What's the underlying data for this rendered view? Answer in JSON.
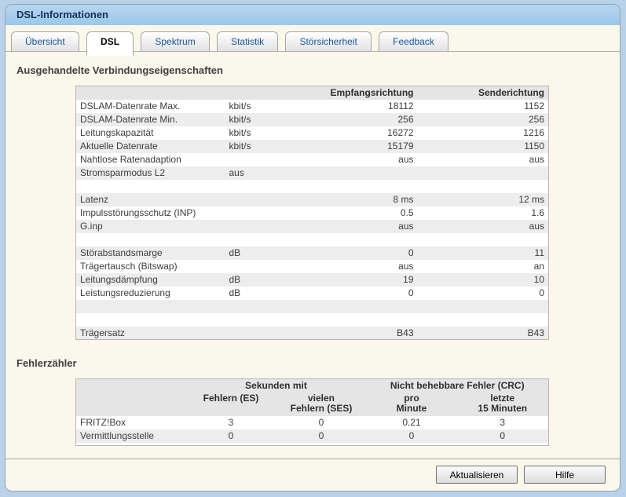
{
  "window": {
    "title": "DSL-Informationen"
  },
  "tabs": [
    {
      "label": "Übersicht",
      "active": false
    },
    {
      "label": "DSL",
      "active": true
    },
    {
      "label": "Spektrum",
      "active": false
    },
    {
      "label": "Statistik",
      "active": false
    },
    {
      "label": "Störsicherheit",
      "active": false
    },
    {
      "label": "Feedback",
      "active": false
    }
  ],
  "connection": {
    "heading": "Ausgehandelte Verbindungseigenschaften",
    "columns": [
      "",
      "",
      "Empfangsrichtung",
      "Senderichtung"
    ],
    "rows": [
      [
        "DSLAM-Datenrate Max.",
        "kbit/s",
        "18112",
        "1152"
      ],
      [
        "DSLAM-Datenrate Min.",
        "kbit/s",
        "256",
        "256"
      ],
      [
        "Leitungskapazität",
        "kbit/s",
        "16272",
        "1216"
      ],
      [
        "Aktuelle Datenrate",
        "kbit/s",
        "15179",
        "1150"
      ],
      [
        "Nahtlose Ratenadaption",
        "",
        "aus",
        "aus"
      ],
      [
        "Stromsparmodus L2",
        "aus",
        "",
        ""
      ],
      [
        "",
        "",
        "",
        ""
      ],
      [
        "Latenz",
        "",
        "8 ms",
        "12 ms"
      ],
      [
        "Impulsstörungsschutz (INP)",
        "",
        "0.5",
        "1.6"
      ],
      [
        "G.inp",
        "",
        "aus",
        "aus"
      ],
      [
        "",
        "",
        "",
        ""
      ],
      [
        "Störabstandsmarge",
        "dB",
        "0",
        "11"
      ],
      [
        "Trägertausch (Bitswap)",
        "",
        "aus",
        "an"
      ],
      [
        "Leitungsdämpfung",
        "dB",
        "19",
        "10"
      ],
      [
        "Leistungsreduzierung",
        "dB",
        "0",
        "0"
      ],
      [
        "",
        "",
        "",
        ""
      ],
      [
        "",
        "",
        "",
        ""
      ],
      [
        "Trägersatz",
        "",
        "B43",
        "B43"
      ]
    ]
  },
  "errors": {
    "heading": "Fehlerzähler",
    "group_headers": [
      "Sekunden mit",
      "Nicht behebbare Fehler (CRC)"
    ],
    "sub_headers": [
      "Fehlern (ES)",
      "vielen\nFehlern (SES)",
      "pro\nMinute",
      "letzte\n15 Minuten"
    ],
    "rows": [
      [
        "FRITZ!Box",
        "3",
        "0",
        "0.21",
        "3"
      ],
      [
        "Vermittlungsstelle",
        "0",
        "0",
        "0",
        "0"
      ]
    ]
  },
  "footer": {
    "refresh_label": "Aktualisieren",
    "help_label": "Hilfe"
  },
  "colors": {
    "titlebar": "#a9cdeb",
    "page_bg": "#b9d2ea",
    "content_bg": "#faf7eb",
    "tab_text": "#14589f",
    "header_bg": "#e5e5e5",
    "stripe": "#ededed"
  }
}
